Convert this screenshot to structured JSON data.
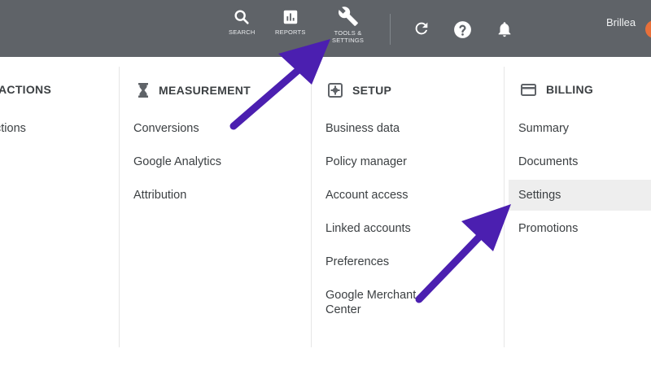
{
  "topbar": {
    "search_label": "SEARCH",
    "reports_label": "REPORTS",
    "tools_label": "TOOLS &\nSETTINGS",
    "user_name": "Brillea"
  },
  "columns": {
    "bulk": {
      "header": "ACTIONS",
      "items": [
        "ctions"
      ]
    },
    "measurement": {
      "header": "MEASUREMENT",
      "items": [
        "Conversions",
        "Google Analytics",
        "Attribution"
      ]
    },
    "setup": {
      "header": "SETUP",
      "items": [
        "Business data",
        "Policy manager",
        "Account access",
        "Linked accounts",
        "Preferences",
        "Google Merchant Center"
      ]
    },
    "billing": {
      "header": "BILLING",
      "items": [
        "Summary",
        "Documents",
        "Settings",
        "Promotions"
      ]
    }
  },
  "colors": {
    "topbar": "#5f6368",
    "arrow": "#4b1fb0",
    "text": "#3c4043",
    "highlight": "#eeeeee"
  },
  "icons": [
    "search-icon",
    "reports-icon",
    "wrench-icon",
    "refresh-icon",
    "help-icon",
    "bell-icon",
    "hourglass-icon",
    "setup-icon",
    "credit-card-icon"
  ]
}
